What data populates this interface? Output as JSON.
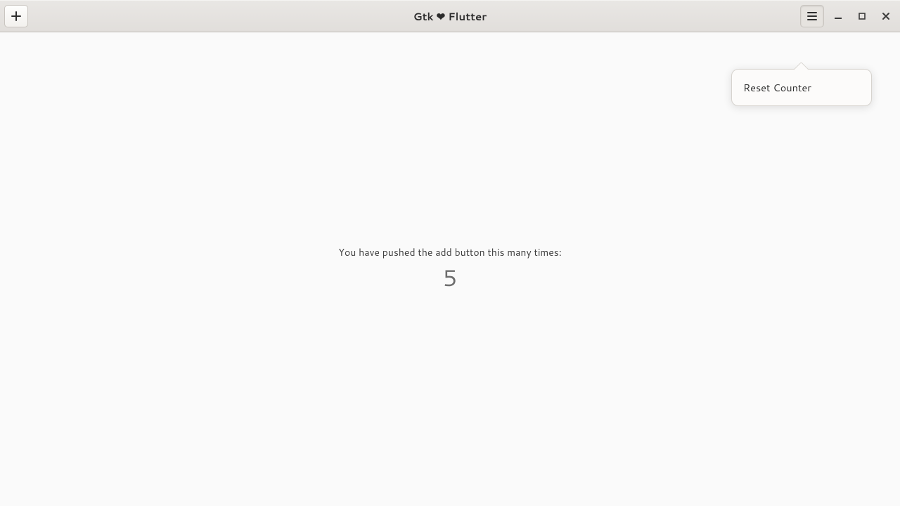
{
  "header": {
    "title": "Gtk ❤ Flutter",
    "add_icon": "plus-icon",
    "menu_icon": "hamburger-icon",
    "minimize_icon": "minimize-icon",
    "maximize_icon": "maximize-icon",
    "close_icon": "close-icon"
  },
  "popover": {
    "items": [
      {
        "label": "Reset Counter"
      }
    ]
  },
  "main": {
    "caption": "You have pushed the add button this many times:",
    "counter_value": "5"
  }
}
